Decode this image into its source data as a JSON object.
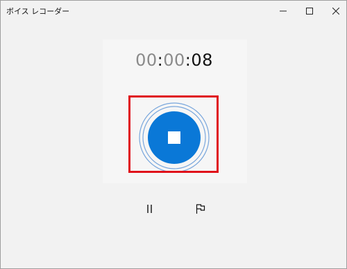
{
  "window": {
    "title": "ボイス レコーダー"
  },
  "timer": {
    "minutes_hours": "00",
    "minutes": "00",
    "seconds": "08",
    "separator": ":"
  },
  "icons": {
    "minimize": "minimize-icon",
    "maximize": "maximize-icon",
    "close": "close-icon",
    "stop": "stop-icon",
    "pause": "pause-icon",
    "flag": "flag-icon"
  },
  "colors": {
    "accent": "#0a78d7",
    "ring": "#78a6dc",
    "highlight": "#e0101a",
    "background": "#f2f2f2"
  }
}
